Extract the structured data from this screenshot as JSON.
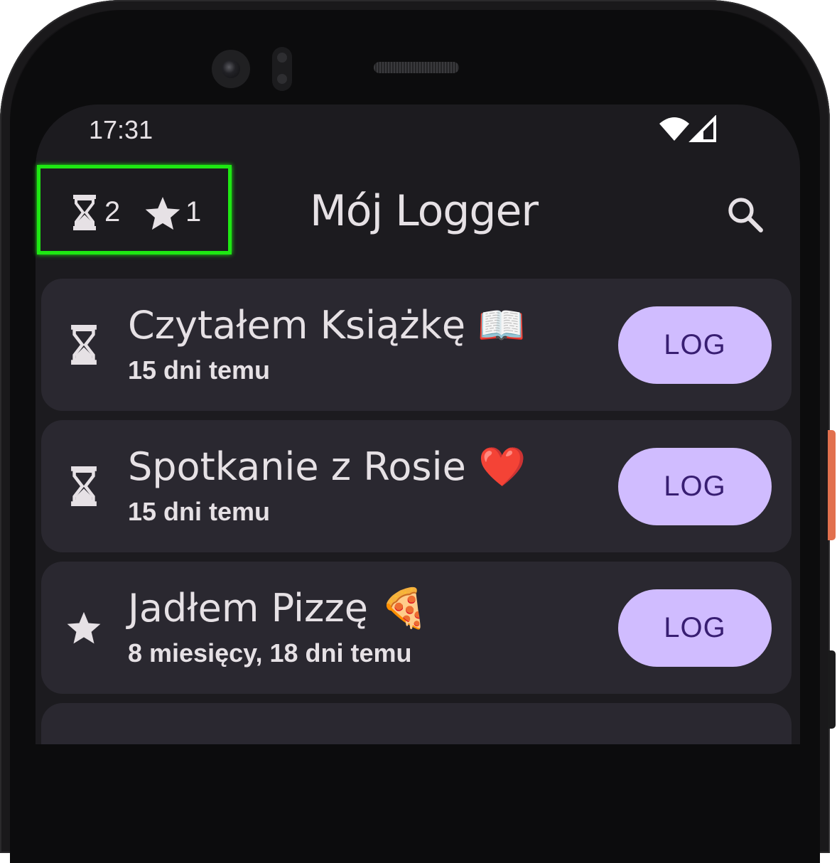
{
  "status_bar": {
    "time": "17:31"
  },
  "app_bar": {
    "title": "Mój Logger",
    "counters": {
      "pending_count": "2",
      "starred_count": "1"
    }
  },
  "entries": [
    {
      "title": "Czytałem Książkę 📖",
      "subtitle": "15 dni temu",
      "icon": "hourglass-icon",
      "button": "LOG"
    },
    {
      "title": "Spotkanie z Rosie ❤️",
      "subtitle": "15 dni temu",
      "icon": "hourglass-icon",
      "button": "LOG"
    },
    {
      "title": "Jadłem Pizzę 🍕",
      "subtitle": "8 miesięcy, 18 dni temu",
      "icon": "star-icon",
      "button": "LOG"
    }
  ],
  "colors": {
    "background": "#1c1b1f",
    "card": "#2a2830",
    "accent_button": "#d0bcff",
    "button_text": "#381e72",
    "highlight": "#1ee813"
  }
}
